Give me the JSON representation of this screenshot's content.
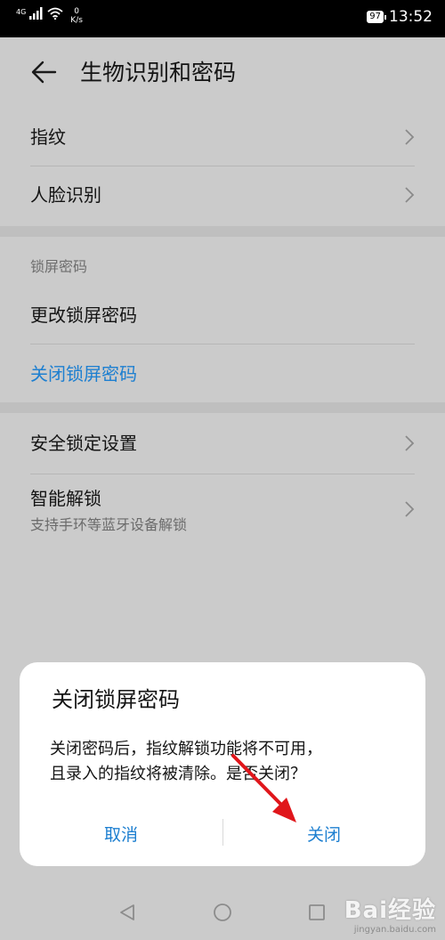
{
  "status_bar": {
    "network": "4G",
    "speed_top": "0",
    "speed_bottom": "K/s",
    "battery": "97",
    "time": "13:52"
  },
  "header": {
    "title": "生物识别和密码"
  },
  "biometrics": {
    "fingerprint": "指纹",
    "face_recognition": "人脸识别"
  },
  "lock_screen": {
    "section_label": "锁屏密码",
    "change_password": "更改锁屏密码",
    "disable_password": "关闭锁屏密码"
  },
  "security": {
    "security_lock_settings": "安全锁定设置",
    "smart_unlock": "智能解锁",
    "smart_unlock_desc": "支持手环等蓝牙设备解锁"
  },
  "dialog": {
    "title": "关闭锁屏密码",
    "message_line1": "关闭密码后，指纹解锁功能将不可用，",
    "message_line2": "且录入的指纹将被清除。是否关闭？",
    "cancel_label": "取消",
    "close_label": "关闭"
  },
  "watermark": {
    "text": "Bai经验",
    "subtext": "jingyan.baidu.com"
  },
  "colors": {
    "accent": "#1d7fd0",
    "annotation_arrow": "#e0161b"
  }
}
